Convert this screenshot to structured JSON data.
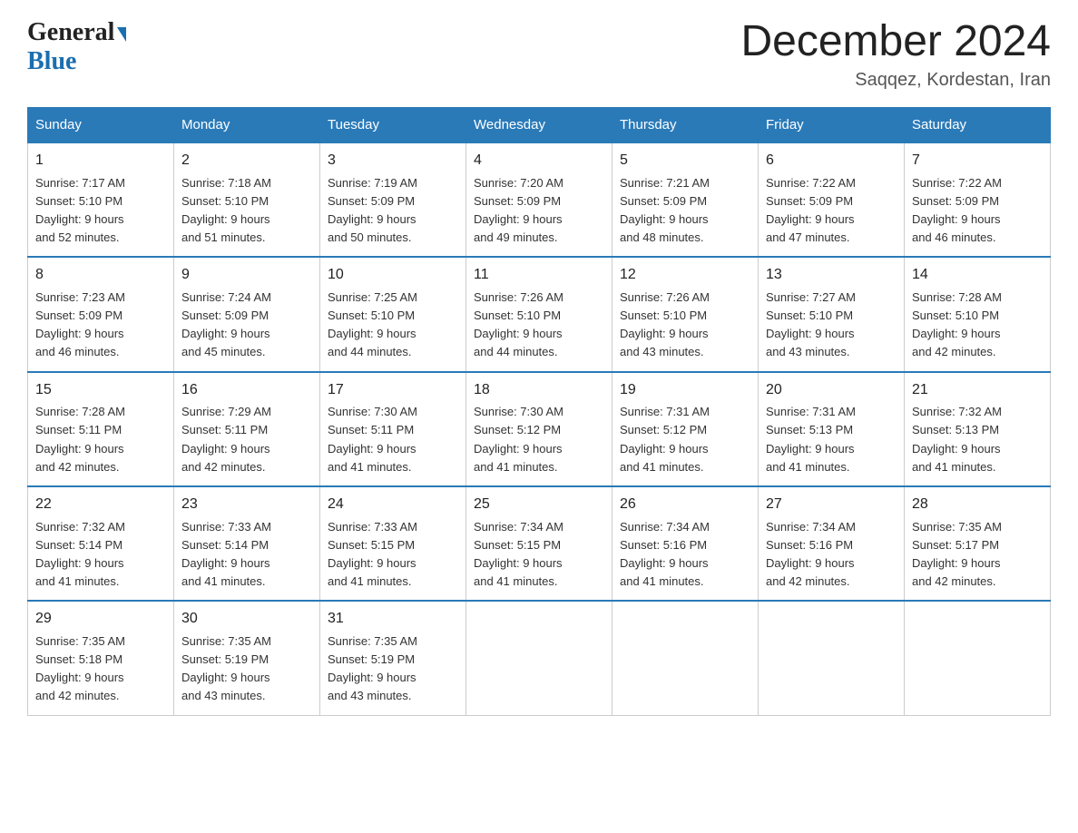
{
  "header": {
    "logo_general": "General",
    "logo_blue": "Blue",
    "month_title": "December 2024",
    "subtitle": "Saqqez, Kordestan, Iran"
  },
  "days_of_week": [
    "Sunday",
    "Monday",
    "Tuesday",
    "Wednesday",
    "Thursday",
    "Friday",
    "Saturday"
  ],
  "weeks": [
    [
      {
        "day": "1",
        "sunrise": "7:17 AM",
        "sunset": "5:10 PM",
        "daylight": "9 hours and 52 minutes."
      },
      {
        "day": "2",
        "sunrise": "7:18 AM",
        "sunset": "5:10 PM",
        "daylight": "9 hours and 51 minutes."
      },
      {
        "day": "3",
        "sunrise": "7:19 AM",
        "sunset": "5:09 PM",
        "daylight": "9 hours and 50 minutes."
      },
      {
        "day": "4",
        "sunrise": "7:20 AM",
        "sunset": "5:09 PM",
        "daylight": "9 hours and 49 minutes."
      },
      {
        "day": "5",
        "sunrise": "7:21 AM",
        "sunset": "5:09 PM",
        "daylight": "9 hours and 48 minutes."
      },
      {
        "day": "6",
        "sunrise": "7:22 AM",
        "sunset": "5:09 PM",
        "daylight": "9 hours and 47 minutes."
      },
      {
        "day": "7",
        "sunrise": "7:22 AM",
        "sunset": "5:09 PM",
        "daylight": "9 hours and 46 minutes."
      }
    ],
    [
      {
        "day": "8",
        "sunrise": "7:23 AM",
        "sunset": "5:09 PM",
        "daylight": "9 hours and 46 minutes."
      },
      {
        "day": "9",
        "sunrise": "7:24 AM",
        "sunset": "5:09 PM",
        "daylight": "9 hours and 45 minutes."
      },
      {
        "day": "10",
        "sunrise": "7:25 AM",
        "sunset": "5:10 PM",
        "daylight": "9 hours and 44 minutes."
      },
      {
        "day": "11",
        "sunrise": "7:26 AM",
        "sunset": "5:10 PM",
        "daylight": "9 hours and 44 minutes."
      },
      {
        "day": "12",
        "sunrise": "7:26 AM",
        "sunset": "5:10 PM",
        "daylight": "9 hours and 43 minutes."
      },
      {
        "day": "13",
        "sunrise": "7:27 AM",
        "sunset": "5:10 PM",
        "daylight": "9 hours and 43 minutes."
      },
      {
        "day": "14",
        "sunrise": "7:28 AM",
        "sunset": "5:10 PM",
        "daylight": "9 hours and 42 minutes."
      }
    ],
    [
      {
        "day": "15",
        "sunrise": "7:28 AM",
        "sunset": "5:11 PM",
        "daylight": "9 hours and 42 minutes."
      },
      {
        "day": "16",
        "sunrise": "7:29 AM",
        "sunset": "5:11 PM",
        "daylight": "9 hours and 42 minutes."
      },
      {
        "day": "17",
        "sunrise": "7:30 AM",
        "sunset": "5:11 PM",
        "daylight": "9 hours and 41 minutes."
      },
      {
        "day": "18",
        "sunrise": "7:30 AM",
        "sunset": "5:12 PM",
        "daylight": "9 hours and 41 minutes."
      },
      {
        "day": "19",
        "sunrise": "7:31 AM",
        "sunset": "5:12 PM",
        "daylight": "9 hours and 41 minutes."
      },
      {
        "day": "20",
        "sunrise": "7:31 AM",
        "sunset": "5:13 PM",
        "daylight": "9 hours and 41 minutes."
      },
      {
        "day": "21",
        "sunrise": "7:32 AM",
        "sunset": "5:13 PM",
        "daylight": "9 hours and 41 minutes."
      }
    ],
    [
      {
        "day": "22",
        "sunrise": "7:32 AM",
        "sunset": "5:14 PM",
        "daylight": "9 hours and 41 minutes."
      },
      {
        "day": "23",
        "sunrise": "7:33 AM",
        "sunset": "5:14 PM",
        "daylight": "9 hours and 41 minutes."
      },
      {
        "day": "24",
        "sunrise": "7:33 AM",
        "sunset": "5:15 PM",
        "daylight": "9 hours and 41 minutes."
      },
      {
        "day": "25",
        "sunrise": "7:34 AM",
        "sunset": "5:15 PM",
        "daylight": "9 hours and 41 minutes."
      },
      {
        "day": "26",
        "sunrise": "7:34 AM",
        "sunset": "5:16 PM",
        "daylight": "9 hours and 41 minutes."
      },
      {
        "day": "27",
        "sunrise": "7:34 AM",
        "sunset": "5:16 PM",
        "daylight": "9 hours and 42 minutes."
      },
      {
        "day": "28",
        "sunrise": "7:35 AM",
        "sunset": "5:17 PM",
        "daylight": "9 hours and 42 minutes."
      }
    ],
    [
      {
        "day": "29",
        "sunrise": "7:35 AM",
        "sunset": "5:18 PM",
        "daylight": "9 hours and 42 minutes."
      },
      {
        "day": "30",
        "sunrise": "7:35 AM",
        "sunset": "5:19 PM",
        "daylight": "9 hours and 43 minutes."
      },
      {
        "day": "31",
        "sunrise": "7:35 AM",
        "sunset": "5:19 PM",
        "daylight": "9 hours and 43 minutes."
      },
      null,
      null,
      null,
      null
    ]
  ],
  "labels": {
    "sunrise": "Sunrise: ",
    "sunset": "Sunset: ",
    "daylight": "Daylight: "
  }
}
